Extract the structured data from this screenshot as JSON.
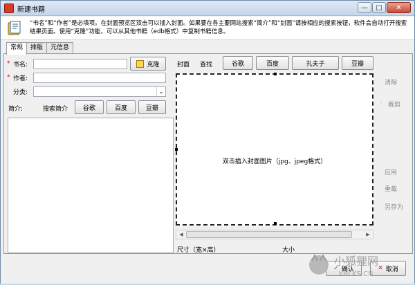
{
  "window": {
    "title": "新建书籍",
    "minimize_icon": "—",
    "maximize_icon": "□",
    "close_icon": "✕"
  },
  "info": {
    "message": "“书名”和“作者”是必填项。在封面预览区双击可以插入封面。如果要在各主要网站搜索“简介”和“封面”请按相应的搜索按钮，软件会自动打开搜索结果页面。使用“克隆”功能，可以从其他书籍（edb格式）中复制书籍信息。"
  },
  "tabs": [
    "常规",
    "排版",
    "元信息"
  ],
  "form": {
    "required_mark": "*",
    "title_label": "书名:",
    "author_label": "作者:",
    "category_label": "分类:",
    "summary_label": "简介:",
    "title_value": "",
    "author_value": "",
    "category_value": "",
    "clone_button": "克隆",
    "search_summary_label": "搜索简介",
    "search_buttons": [
      "谷歌",
      "百度",
      "豆瓣"
    ],
    "summary_value": ""
  },
  "cover": {
    "cover_label": "封面",
    "search_label": "查找",
    "search_buttons": [
      "谷歌",
      "百度",
      "孔夫子",
      "豆瓣"
    ],
    "placeholder": "双击插入封面图片（jpg、jpeg格式）",
    "size_label": "尺寸（宽×高）",
    "filesize_label": "大小",
    "scroll_left": "◀",
    "scroll_right": "▶"
  },
  "side_actions": {
    "clear": "清除",
    "crop": "裁剪",
    "apply": "应用",
    "reset": "重载",
    "save_as": "另存为"
  },
  "footer": {
    "ok": "确认",
    "cancel": "取消"
  },
  "watermark": {
    "chinese": "小狐狸网",
    "latin": "XHLKS.CN"
  }
}
